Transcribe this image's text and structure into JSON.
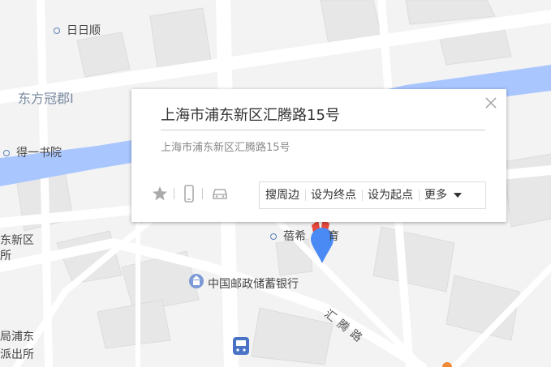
{
  "map": {
    "labels": {
      "poi_ririshun": "日日顺",
      "district_dongfang": "东方冠郡I",
      "poi_bookstore": "得一书院",
      "district_left": "东新区",
      "district_left2": "所",
      "poi_peixi": "蓓希",
      "poi_peixi_tail": "育",
      "poi_bank": "中国邮政储蓄银行",
      "road_huiteng": "汇腾路",
      "police_1": "局浦东",
      "police_2": "派出所"
    },
    "colors": {
      "background": "#f3f3f3",
      "road": "#ffffff",
      "block": "#e6e6e6",
      "river": "#a9c6ff",
      "pin": "#4a8af4",
      "pin_red": "#e8473c"
    }
  },
  "popup": {
    "title": "上海市浦东新区汇腾路15号",
    "subtitle": "上海市浦东新区汇腾路15号",
    "icons": {
      "close": "close-icon",
      "favorite": "star-icon",
      "phone": "phone-icon",
      "car": "car-icon"
    },
    "actions": {
      "search_nearby": "搜周边",
      "set_end": "设为终点",
      "set_start": "设为起点",
      "more": "更多"
    }
  }
}
